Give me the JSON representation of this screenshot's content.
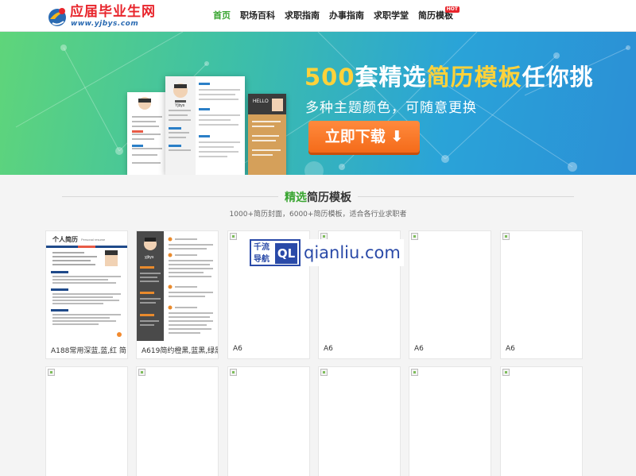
{
  "brand": {
    "title": "应届毕业生网",
    "url": "www.yjbys.com"
  },
  "nav": {
    "items": [
      {
        "label": "首页",
        "active": true
      },
      {
        "label": "职场百科",
        "active": false
      },
      {
        "label": "求职指南",
        "active": false
      },
      {
        "label": "办事指南",
        "active": false
      },
      {
        "label": "求职学堂",
        "active": false
      },
      {
        "label": "简历模板",
        "active": false,
        "badge": "HOT"
      }
    ]
  },
  "banner": {
    "title_num": "500",
    "title_part1": "套精选",
    "title_part2": "简历模板",
    "title_part3": "任你挑",
    "subtitle": "多种主题颜色，可随意更换",
    "button_label": "立即下载 ⬇",
    "preview_name": "Yjbys",
    "preview_hello": "HELLO",
    "colors": {
      "green": "#5fd57a",
      "blue": "#2b8fd6",
      "yellow": "#ffd23a",
      "orange": "#f46b1a"
    }
  },
  "section": {
    "title_hl": "精选",
    "title_rest": "简历模板",
    "subtitle": "1000+简历封面，6000+简历模板，适合各行业求职者"
  },
  "templates": [
    {
      "label": "A188常用深蓝,蓝,红 简",
      "thumb": "resume-blue",
      "thumb_heading": "个人简历",
      "thumb_heading_en": "Personal resume"
    },
    {
      "label": "A619简约橙黑,蓝黑,绿黑",
      "thumb": "resume-dark",
      "thumb_name": "yjbys"
    },
    {
      "label": "A6",
      "thumb": "broken"
    },
    {
      "label": "A6",
      "thumb": "broken"
    },
    {
      "label": "A6",
      "thumb": "broken"
    },
    {
      "label": "A6",
      "thumb": "broken"
    },
    {
      "label": "",
      "thumb": "broken"
    },
    {
      "label": "",
      "thumb": "broken"
    },
    {
      "label": "",
      "thumb": "broken"
    },
    {
      "label": "",
      "thumb": "broken"
    },
    {
      "label": "",
      "thumb": "broken"
    },
    {
      "label": "",
      "thumb": "broken"
    }
  ],
  "watermark": {
    "zh": "千流导航",
    "ql": "QL",
    "domain": "qianliu.com"
  }
}
